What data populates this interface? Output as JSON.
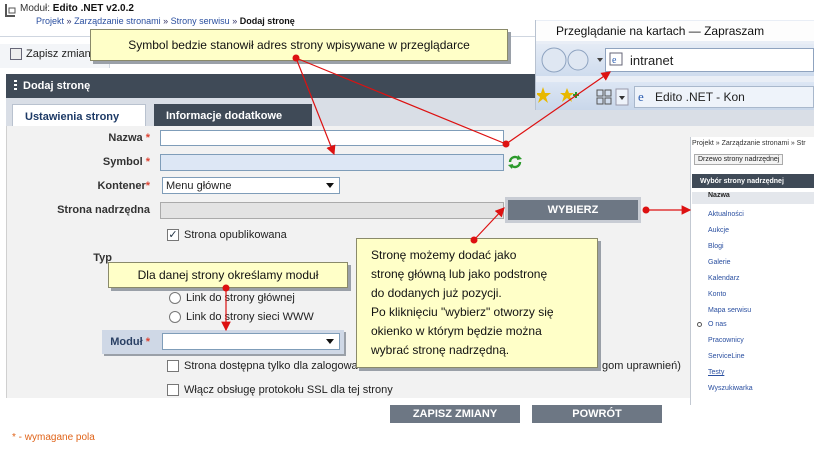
{
  "header": {
    "module_label": "Moduł:",
    "module_name": "Edito .NET v2.0.2",
    "breadcrumb": [
      "Projekt",
      "Zarządzanie stronami",
      "Strony serwisu"
    ],
    "breadcrumb_sep": "»",
    "breadcrumb_current": "Dodaj stronę"
  },
  "toolbar": {
    "save_label": "Zapisz zmiany"
  },
  "panel": {
    "title": "Dodaj stronę",
    "tabs": [
      {
        "label": "Ustawienia strony",
        "active": true
      },
      {
        "label": "Informacje dodatkowe",
        "active": false
      }
    ]
  },
  "form": {
    "required_mark": "*",
    "nazwa_label": "Nazwa",
    "nazwa_value": "",
    "symbol_label": "Symbol",
    "symbol_value": "",
    "kontener_label": "Kontener",
    "kontener_value": "Menu główne",
    "nadrzedna_label": "Strona nadrzędna",
    "nadrzedna_value": "",
    "wybierz_label": "WYBIERZ",
    "opublikowana_label": "Strona opublikowana",
    "typ_label": "Typ",
    "radio_1": "Link do strony głównej",
    "radio_2": "Link do strony sieci WWW",
    "modul_label": "Moduł",
    "modul_value": "",
    "dostepna_label": "Strona dostępna tylko dla zalogowa",
    "dostepna_suffix": "gom uprawnień)",
    "ssl_label": "Włącz obsługę protokołu SSL dla tej strony",
    "submit_label": "ZAPISZ ZMIANY",
    "back_label": "POWRÓT"
  },
  "footer": {
    "required_note": "* - wymagane pola"
  },
  "callouts": {
    "symbol": "Symbol bedzie stanowił adres strony wpisywane w przeglądarce",
    "modul": "Dla danej strony określamy moduł",
    "parent_lines": [
      "Stronę możemy dodać jako",
      "stronę główną lub jako podstronę",
      "do dodanych już pozycji.",
      "Po kliknięciu \"wybierz\" otworzy się",
      "okienko w którym będzie można",
      "wybrać stronę nadrzędną."
    ]
  },
  "browser": {
    "window_title": "Przeglądanie na kartach — Zapraszam",
    "address": "intranet",
    "tab_title": "Edito .NET - Kon"
  },
  "popup": {
    "breadcrumb": "Projekt » Zarządzanie stronami » Str",
    "button": "Drzewo strony nadrzędnej",
    "title": "Wybór strony nadrzędnej",
    "column": "Nazwa",
    "items": [
      "Aktualności",
      "Aukcje",
      "Blogi",
      "Galerie",
      "Kalendarz",
      "Konto",
      "Mapa serwisu",
      "O nas",
      "Pracownicy",
      "ServiceLine",
      "Testy",
      "Wyszukiwarka"
    ]
  },
  "colors": {
    "accent_dark": "#3f4a57",
    "callout_bg": "#ffffc8",
    "arrow_red": "#dd1111",
    "required": "#d43"
  }
}
